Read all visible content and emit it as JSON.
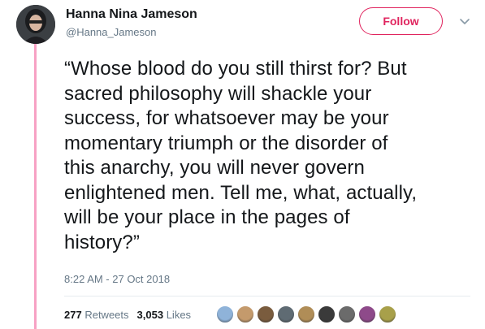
{
  "author": {
    "name": "Hanna Nina Jameson",
    "handle": "@Hanna_Jameson"
  },
  "follow_label": "Follow",
  "tweet": {
    "lines": [
      "“Whose blood do you still thirst for? But",
      "sacred philosophy will shackle your",
      "success, for whatsoever may be your",
      "momentary triumph or the disorder of",
      "this anarchy, you will never govern",
      "enlightened men. Tell me, what, actually,",
      "will be your place in the pages of",
      "history?”"
    ],
    "timestamp": "8:22 AM - 27 Oct 2018"
  },
  "stats": {
    "retweets_count": "277",
    "retweets_label": "Retweets",
    "likes_count": "3,053",
    "likes_label": "Likes"
  },
  "colors": {
    "accent": "#e0245e",
    "thread_line": "#f7a1c4",
    "secondary_text": "#657786"
  },
  "icons": {
    "menu": "chevron-down-icon"
  },
  "likers": [
    {
      "name": "liker-avatar-1",
      "color": "#8fb3d9"
    },
    {
      "name": "liker-avatar-2",
      "color": "#c49a6c"
    },
    {
      "name": "liker-avatar-3",
      "color": "#7a5c3e"
    },
    {
      "name": "liker-avatar-4",
      "color": "#5f6b73"
    },
    {
      "name": "liker-avatar-5",
      "color": "#b08d57"
    },
    {
      "name": "liker-avatar-6",
      "color": "#3a3a3a"
    },
    {
      "name": "liker-avatar-7",
      "color": "#6b6b6b"
    },
    {
      "name": "liker-avatar-8",
      "color": "#8e4a8a"
    },
    {
      "name": "liker-avatar-9",
      "color": "#a8a04a"
    }
  ]
}
